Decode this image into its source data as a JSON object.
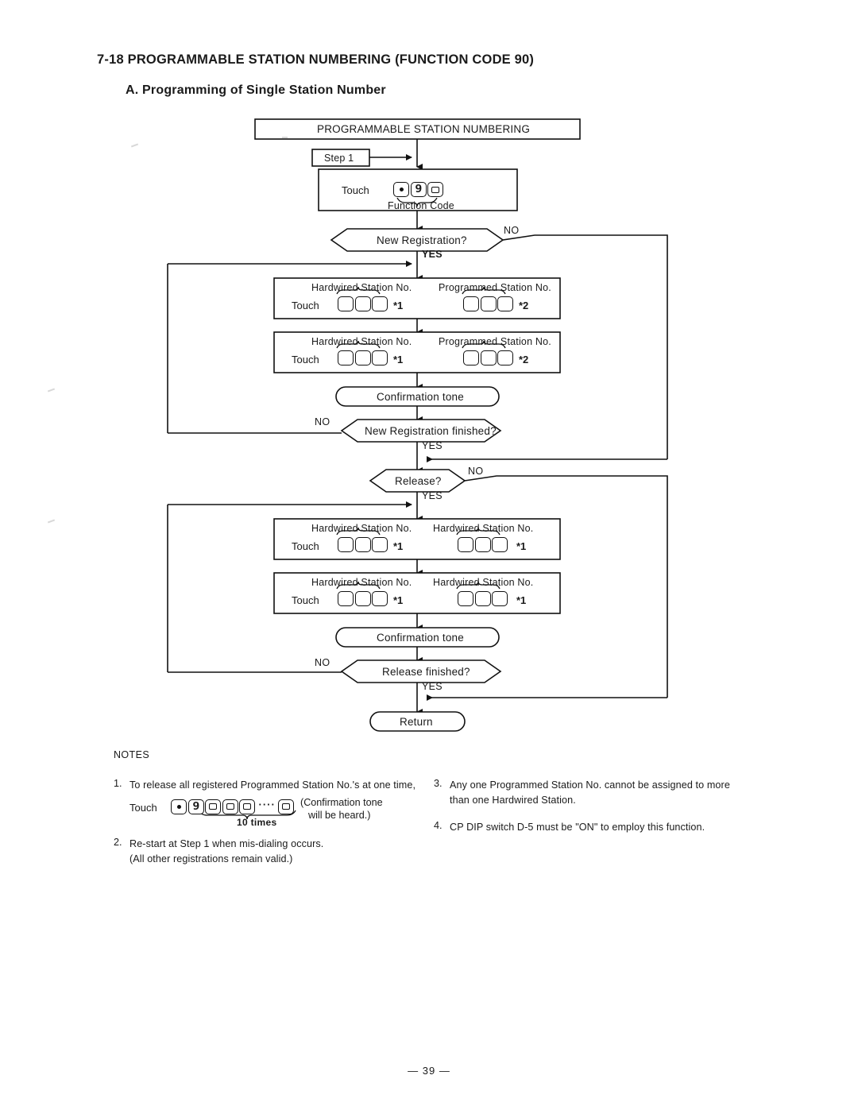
{
  "document": {
    "title": "7-18 PROGRAMMABLE STATION NUMBERING (FUNCTION CODE 90)",
    "subtitle": "A. Programming of Single Station Number",
    "page_number": "— 39 —"
  },
  "flowchart": {
    "start_box": "PROGRAMMABLE STATION NUMBERING",
    "step_marker": "Step  1",
    "function_code_step": {
      "touch_label": "Touch",
      "keys": [
        "dot",
        "9",
        "0"
      ],
      "caption": "Function  Code"
    },
    "decisions": {
      "new_registration": "New Registration?",
      "new_registration_finished": "New Registration finished?",
      "release": "Release?",
      "release_finished": "Release finished?"
    },
    "branch_yes": "YES",
    "branch_no": "NO",
    "confirmation_tone": "Confirmation tone",
    "return_node": "Return",
    "registration_steps": [
      {
        "touch_label": "Touch",
        "left_heading": "Hardwired Station No.",
        "left_keys": [
          "",
          "",
          ""
        ],
        "left_note": "*1",
        "right_heading": "Programmed Station No.",
        "right_keys": [
          "",
          "",
          ""
        ],
        "right_note": "*2"
      },
      {
        "touch_label": "Touch",
        "left_heading": "Hardwired Station No.",
        "left_keys": [
          "",
          "",
          ""
        ],
        "left_note": "*1",
        "right_heading": "Programmed Station No.",
        "right_keys": [
          "",
          "",
          ""
        ],
        "right_note": "*2"
      }
    ],
    "release_steps": [
      {
        "touch_label": "Touch",
        "left_heading": "Hardwired Station No.",
        "left_keys": [
          "",
          "",
          ""
        ],
        "left_note": "*1",
        "right_heading": "Hardwired Station No.",
        "right_keys": [
          "",
          "",
          ""
        ],
        "right_note": "*1"
      },
      {
        "touch_label": "Touch",
        "left_heading": "Hardwired Station No.",
        "left_keys": [
          "",
          "",
          ""
        ],
        "left_note": "*1",
        "right_heading": "Hardwired Station No.",
        "right_keys": [
          "",
          "",
          ""
        ],
        "right_note": "*1"
      }
    ]
  },
  "notes": {
    "heading": "NOTES",
    "items": [
      {
        "number": "1.",
        "text": "To release all registered Programmed Station No.'s at one time,",
        "touch_label": "Touch",
        "keys": [
          "dot",
          "9",
          "0",
          "0",
          "0",
          "dots",
          "0"
        ],
        "brace_label": "10 times",
        "aside_line1": "(Confirmation tone",
        "aside_line2": "will be heard.)"
      },
      {
        "number": "2.",
        "line1": "Re-start at Step 1 when mis-dialing occurs.",
        "line2": "(All other registrations remain valid.)"
      },
      {
        "number": "3.",
        "line1": "Any one Programmed Station No. cannot be assigned to more",
        "line2": "than one Hardwired Station."
      },
      {
        "number": "4.",
        "line1": "CP  DIP switch D-5 must be \"ON\" to employ this function.",
        "line2": ""
      }
    ]
  },
  "colors": {
    "ink": "#1a1a1a",
    "paper": "#ffffff",
    "line": "#111111"
  }
}
